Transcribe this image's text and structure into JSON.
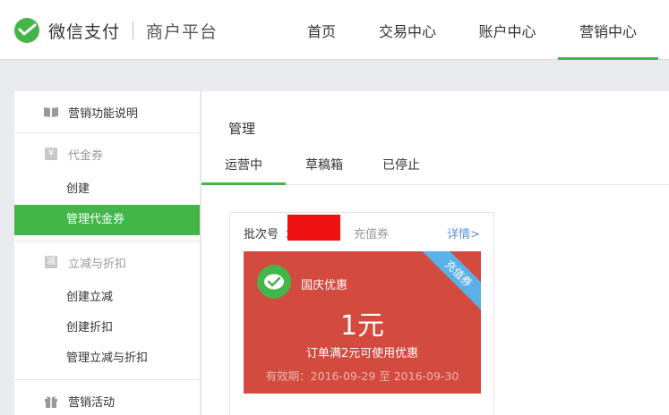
{
  "header": {
    "brand": "微信支付",
    "sub": "商户平台",
    "nav": [
      {
        "label": "首页"
      },
      {
        "label": "交易中心"
      },
      {
        "label": "账户中心"
      },
      {
        "label": "营销中心"
      }
    ],
    "active_nav": "营销中心"
  },
  "sidebar": {
    "groups": [
      {
        "title": "营销功能说明",
        "icon": "book-icon",
        "items": []
      },
      {
        "title": "代金券",
        "icon": "yen-icon",
        "items": [
          "创建",
          "管理代金券"
        ]
      },
      {
        "title": "立减与折扣",
        "icon": "minus-badge-icon",
        "icon_char": "减",
        "items": [
          "创建立减",
          "创建折扣",
          "管理立减与折扣"
        ]
      },
      {
        "title": "营销活动",
        "icon": "gift-icon",
        "items": []
      }
    ],
    "active_item": "管理代金券"
  },
  "main": {
    "title": "管理",
    "tabs": [
      "运营中",
      "草稿箱",
      "已停止"
    ],
    "active_tab": "运营中",
    "card": {
      "batch_label": "批次号",
      "batch_colon": "：",
      "type": "充值券",
      "detail": "详情>",
      "coupon": {
        "name": "国庆优惠",
        "ribbon": "充值券",
        "value": "1元",
        "condition": "订单满2元可使用优惠",
        "validity": "有效期：2016-09-29 至 2016-09-30"
      }
    }
  },
  "colors": {
    "accent": "#44b549",
    "coupon_bg": "#d34a3f",
    "ribbon": "#5bb0ea",
    "link": "#5b8fd5",
    "redaction": "#ee1111"
  }
}
